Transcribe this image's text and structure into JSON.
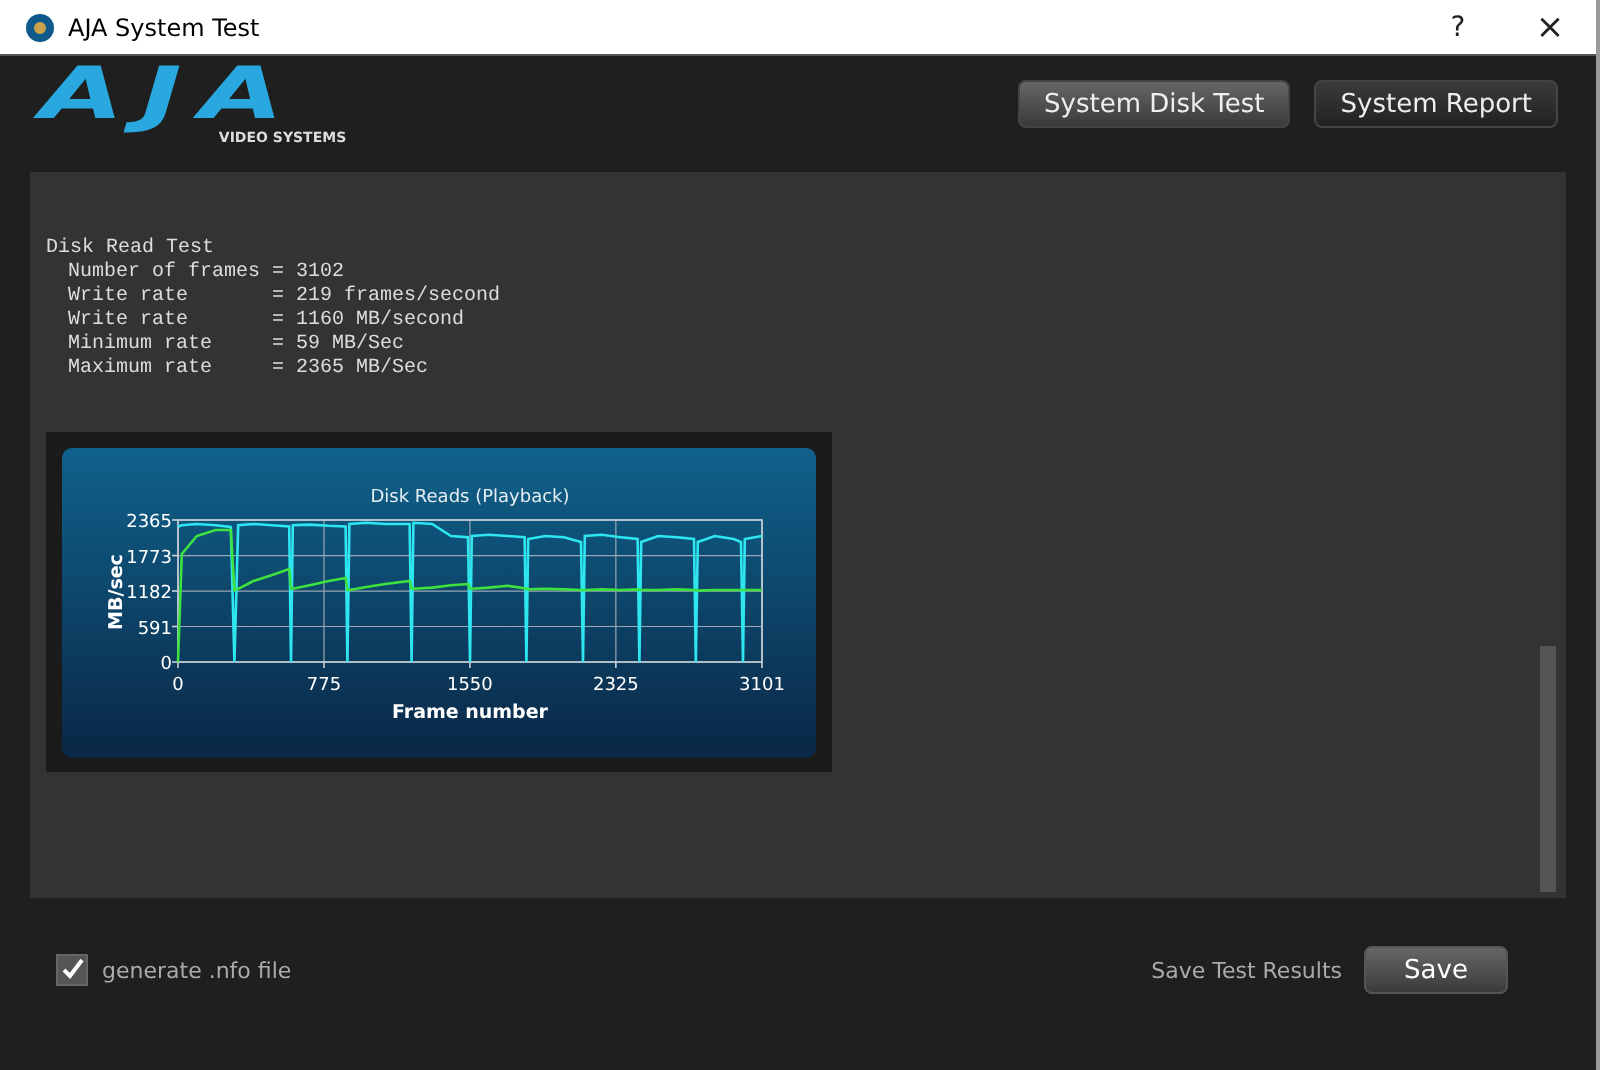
{
  "window": {
    "title": "AJA System Test",
    "help": "?",
    "close": "×"
  },
  "logo": {
    "brand": "AJA",
    "tagline": "VIDEO SYSTEMS"
  },
  "header_buttons": [
    "System Disk Test",
    "System Report"
  ],
  "results": {
    "heading": "Disk Read Test",
    "lines": [
      "Number of frames = 3102",
      "Write rate       = 219 frames/second",
      "Write rate       = 1160 MB/second",
      "Minimum rate     = 59 MB/Sec",
      "Maximum rate     = 2365 MB/Sec"
    ]
  },
  "chart_data": {
    "type": "line",
    "title": "Disk Reads (Playback)",
    "xlabel": "Frame number",
    "ylabel": "MB/sec",
    "x": [
      0,
      20,
      100,
      200,
      280,
      300,
      320,
      400,
      500,
      590,
      600,
      610,
      700,
      800,
      890,
      900,
      910,
      1000,
      1100,
      1230,
      1240,
      1250,
      1350,
      1450,
      1540,
      1550,
      1560,
      1650,
      1750,
      1840,
      1850,
      1860,
      1950,
      2050,
      2140,
      2150,
      2160,
      2250,
      2350,
      2440,
      2450,
      2460,
      2550,
      2650,
      2740,
      2750,
      2760,
      2850,
      2950,
      2990,
      3000,
      3010,
      3101
    ],
    "series": [
      {
        "color": "#2ee6f0",
        "values": [
          2250,
          2280,
          2300,
          2280,
          2250,
          0,
          2280,
          2300,
          2280,
          2260,
          0,
          2280,
          2290,
          2270,
          2260,
          0,
          2300,
          2320,
          2300,
          2300,
          0,
          2320,
          2300,
          2100,
          2080,
          0,
          2100,
          2120,
          2100,
          2080,
          0,
          2050,
          2100,
          2080,
          2000,
          0,
          2100,
          2120,
          2080,
          2050,
          0,
          2000,
          2100,
          2080,
          2050,
          0,
          2000,
          2100,
          2050,
          2000,
          0,
          2050,
          2100
        ]
      },
      {
        "color": "#3ee23e",
        "values": [
          0,
          1800,
          2100,
          2200,
          2200,
          1200,
          1220,
          1350,
          1450,
          1550,
          1220,
          1220,
          1280,
          1350,
          1400,
          1200,
          1200,
          1250,
          1300,
          1350,
          1220,
          1220,
          1240,
          1280,
          1300,
          1220,
          1220,
          1240,
          1270,
          1230,
          1220,
          1210,
          1220,
          1210,
          1200,
          1200,
          1200,
          1210,
          1200,
          1210,
          1200,
          1200,
          1200,
          1210,
          1200,
          1200,
          1190,
          1200,
          1200,
          1200,
          1200,
          1200,
          1200
        ]
      }
    ],
    "grid": true,
    "xlim": [
      0,
      3101
    ],
    "ylim": [
      0,
      2365
    ],
    "xticks": [
      0,
      775,
      1550,
      2325,
      3101
    ],
    "yticks": [
      0,
      591,
      1182,
      1773,
      2365
    ]
  },
  "footer": {
    "nfo": {
      "label": "generate .nfo file",
      "checked": true
    },
    "save_label": "Save Test Results",
    "save_button": "Save"
  }
}
